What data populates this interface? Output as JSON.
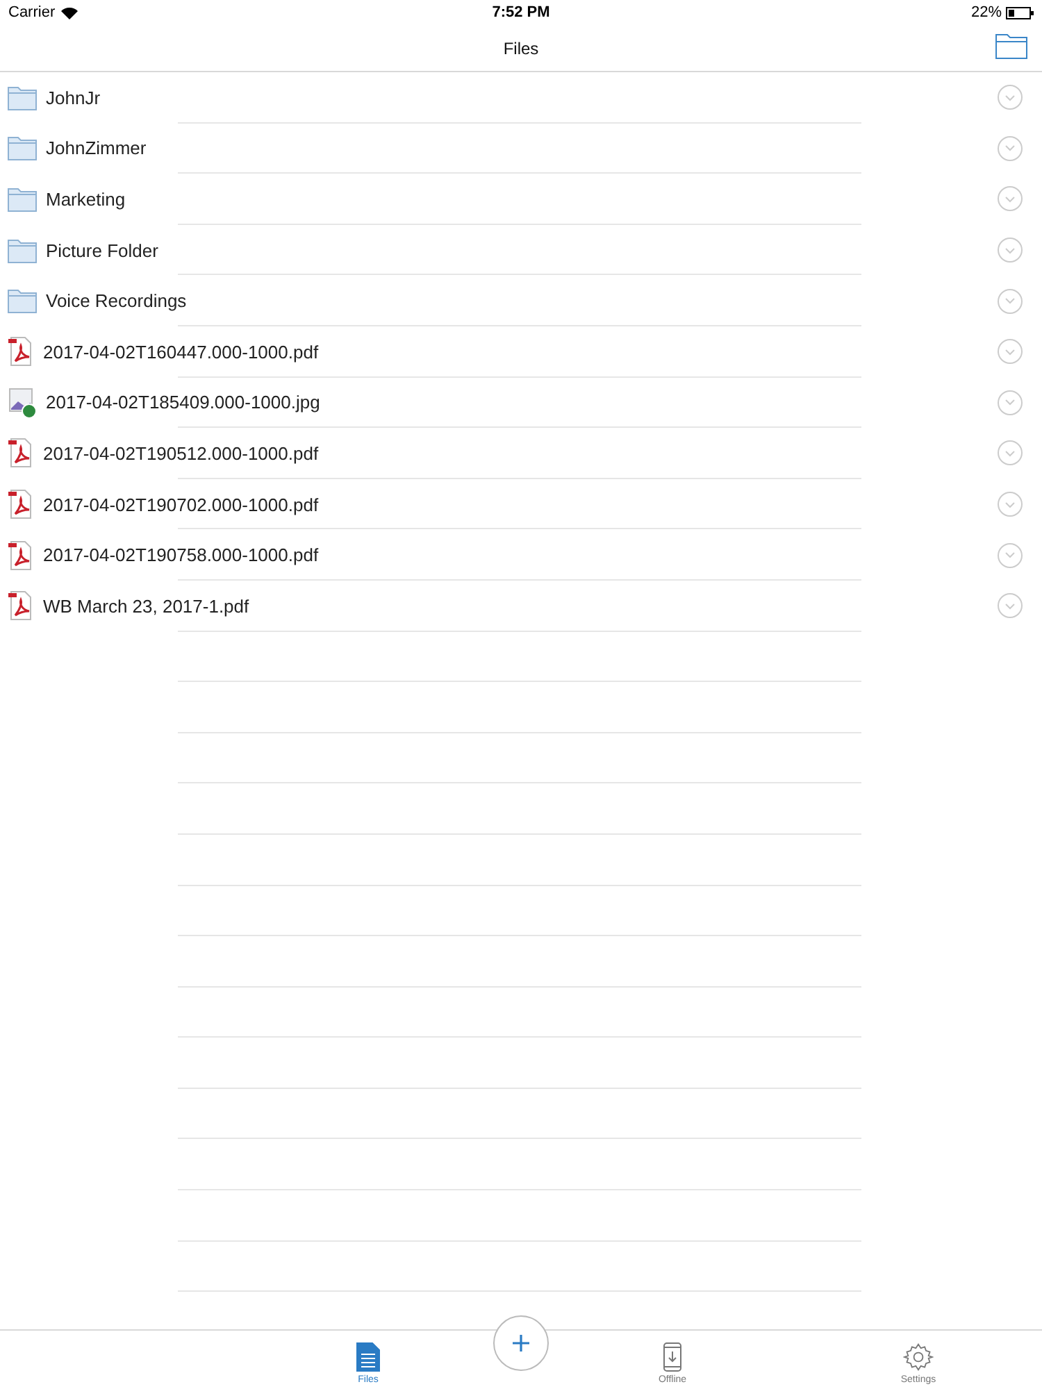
{
  "status_bar": {
    "carrier": "Carrier",
    "time": "7:52 PM",
    "battery": "22%"
  },
  "nav_bar": {
    "title": "Files"
  },
  "files": [
    {
      "kind": "folder",
      "name": "JohnJr"
    },
    {
      "kind": "folder",
      "name": "JohnZimmer"
    },
    {
      "kind": "folder",
      "name": "Marketing"
    },
    {
      "kind": "folder",
      "name": "Picture Folder"
    },
    {
      "kind": "folder",
      "name": "Voice Recordings"
    },
    {
      "kind": "pdf",
      "name": "2017-04-02T160447.000-1000.pdf"
    },
    {
      "kind": "image",
      "name": "2017-04-02T185409.000-1000.jpg"
    },
    {
      "kind": "pdf",
      "name": "2017-04-02T190512.000-1000.pdf"
    },
    {
      "kind": "pdf",
      "name": "2017-04-02T190702.000-1000.pdf"
    },
    {
      "kind": "pdf",
      "name": "2017-04-02T190758.000-1000.pdf"
    },
    {
      "kind": "pdf",
      "name": "WB March 23, 2017-1.pdf"
    }
  ],
  "tab_bar": [
    {
      "kind": "files",
      "label": "Files",
      "selected": true
    },
    {
      "kind": "add"
    },
    {
      "kind": "offline",
      "label": "Offline",
      "selected": false
    },
    {
      "kind": "settings",
      "label": "Settings",
      "selected": false
    }
  ]
}
